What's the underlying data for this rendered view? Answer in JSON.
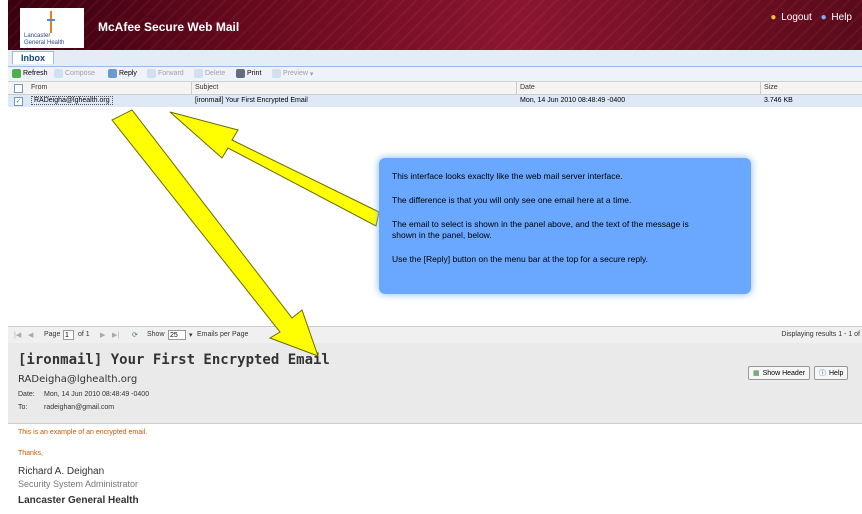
{
  "brand": {
    "logo_text_1": "Lancaster",
    "logo_text_2": "General Health",
    "app_title": "McAfee Secure Web Mail"
  },
  "top_links": {
    "logout": "Logout",
    "help": "Help"
  },
  "tabs": {
    "inbox": "Inbox"
  },
  "toolbar": {
    "refresh": "Refresh",
    "compose": "Compose",
    "reply": "Reply",
    "forward": "Forward",
    "delete": "Delete",
    "print": "Print",
    "preview": "Preview"
  },
  "grid": {
    "headers": {
      "from": "From",
      "subject": "Subject",
      "date": "Date",
      "size": "Size"
    },
    "row": {
      "from": "RADeigha@lghealth.org",
      "subject": "[ironmail] Your First Encrypted Email",
      "date": "Mon, 14 Jun 2010 08:48:49 -0400",
      "size": "3.746 KB"
    }
  },
  "pager": {
    "page_label": "Page",
    "page_value": "1",
    "of_label": "of 1",
    "show_label": "Show",
    "show_value": "25",
    "per_page": "Emails per Page",
    "displaying": "Displaying results 1 - 1 of"
  },
  "message": {
    "subject": "[ironmail] Your First Encrypted Email",
    "sender": "RADeigha@lghealth.org",
    "date_label": "Date:",
    "date_value": "Mon, 14 Jun 2010 08:48:49 -0400",
    "to_label": "To:",
    "to_value": "radeighan@gmail.com",
    "show_header": "Show Header",
    "help": "Help",
    "body_line1": "This is an example of an encrypted email.",
    "body_line2": "Thanks,",
    "sig_name": "Richard A. Deighan",
    "sig_title": "Security System Administrator",
    "sig_org": "Lancaster General Health"
  },
  "callout": {
    "p1": "This interface looks exaclty like the web mail server interface.",
    "p2": "The difference is that you will only see one email here at a time.",
    "p3": "The email to select is shown in the panel above, and the text of the message is shown in the panel, below.",
    "p4": "Use the [Reply] button on the menu bar at the top for a secure reply."
  },
  "colors": {
    "banner": "#6a0a1e",
    "callout": "#6aa8ff",
    "arrow": "#ffff00",
    "selected_row": "#dfe8f6"
  }
}
